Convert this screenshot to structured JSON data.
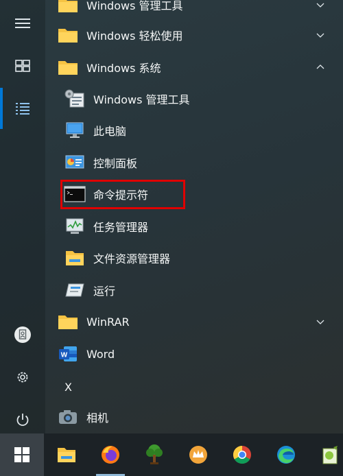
{
  "rail": {
    "items": [
      {
        "name": "hamburger-menu",
        "icon": "hamburger-icon"
      },
      {
        "name": "tiles-view",
        "icon": "tiles-icon"
      },
      {
        "name": "all-apps-list",
        "icon": "list-icon",
        "active": true
      },
      {
        "name": "user-document",
        "icon": "document-icon"
      },
      {
        "name": "settings",
        "icon": "gear-icon"
      },
      {
        "name": "power",
        "icon": "power-icon"
      }
    ]
  },
  "apps": {
    "folder_top_partial": "Windows 管理工具",
    "folder_easeofaccess": "Windows 轻松使用",
    "folder_system": "Windows 系统",
    "sys_admin_tools": "Windows 管理工具",
    "sys_this_pc": "此电脑",
    "sys_control_panel": "控制面板",
    "sys_cmd": "命令提示符",
    "sys_task_manager": "任务管理器",
    "sys_file_explorer": "文件资源管理器",
    "sys_run": "运行",
    "folder_winrar": "WinRAR",
    "app_word": "Word",
    "section_x": "X",
    "app_camera": "相机"
  },
  "colors": {
    "accent": "#0078d7",
    "highlight": "#e00000",
    "folder": "#f6c343"
  },
  "taskbar": {
    "apps": [
      "start-icon",
      "file-explorer-icon",
      "firefox-icon",
      "tree-app-icon",
      "crown-app-icon",
      "chrome-icon",
      "edge-icon",
      "notepad-plus-icon"
    ]
  }
}
